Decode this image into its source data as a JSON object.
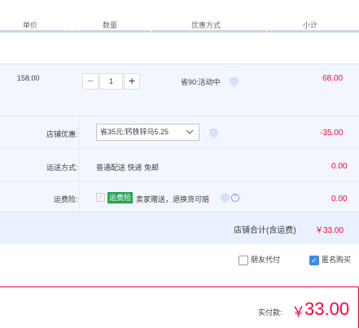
{
  "header": {
    "cols": [
      "单价",
      "数量",
      "优惠方式",
      "小计"
    ]
  },
  "item": {
    "price": "158.00",
    "quantity": "1",
    "minus": "−",
    "plus": "+",
    "promo": "省90:活动中",
    "subtotal": "68.00"
  },
  "store": {
    "coupon_label": "店铺优惠:",
    "coupon_value": "省35元:钙铁锌马5.25",
    "coupon_amount": "-35.00",
    "shipping_label": "运送方式:",
    "shipping_value": "普通配送 快递 免邮",
    "shipping_amount": "0.00",
    "insurance_label": "运费险:",
    "insurance_tag": "运费险",
    "insurance_desc": "卖家赠送，退换货可赔",
    "insurance_amount": "0.00",
    "total_label": "店铺合计(含运费)",
    "total_value": "￥33.00"
  },
  "options": {
    "friend_pay": "朋友代付",
    "anonymous": "匿名购买",
    "friend_pay_checked": false,
    "anonymous_checked": true
  },
  "payment": {
    "label": "实付款:",
    "currency": "￥",
    "amount": "33.00"
  },
  "colors": {
    "accent_red": "#ff0036",
    "header_line": "#c7d7e6",
    "panel_bg": "#f2f7ff",
    "green_tag": "#22a553",
    "checkbox_blue": "#3d8be5"
  },
  "icons": [
    "chevron-down-icon",
    "chat-bubble-icon",
    "help-icon",
    "check-icon"
  ]
}
